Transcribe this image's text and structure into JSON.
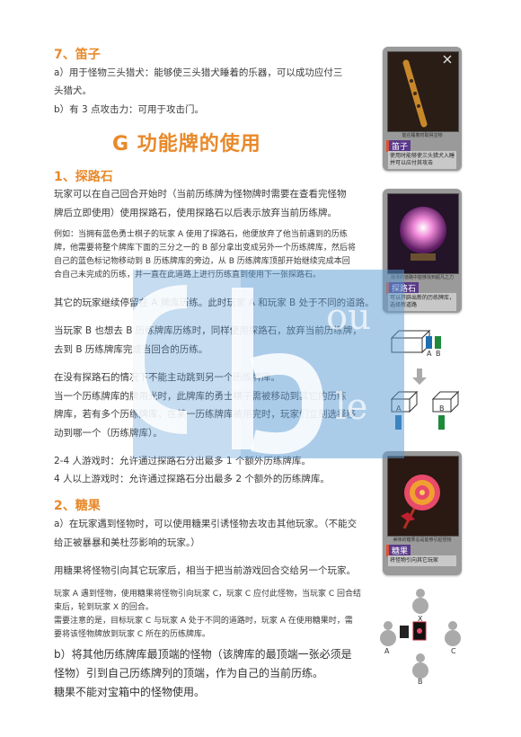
{
  "sec7": {
    "heading": "7、笛子",
    "line_a": "a）用于怪物三头猎犬：能够使三头猎犬睡着的乐器，可以成功应付三",
    "line_a2": "头猎犬。",
    "line_b": "b）有 3 点攻击力：可用于攻击门。"
  },
  "main_title": "G 功能牌的使用",
  "sec1": {
    "heading": "1、探路石",
    "p1_l1": "玩家可以在自己回合开始时（当前历练牌为怪物牌时需要在查看完怪物",
    "p1_l2": "牌后立即使用）使用探路石，使用探路石以后表示放弃当前历练牌。",
    "ex_l1": "例如：当拥有蓝色勇士棋子的玩家 A 使用了探路石，他便放弃了他当前遇到的历练",
    "ex_l2": "牌，他需要将整个牌库下面的三分之一的 B 部分拿出变成另外一个历练牌库，然后将",
    "ex_l3": "自己的蓝色标记物移动到 B 历练牌库的旁边，从 B 历练牌库顶部开始继续完成本回",
    "ex_l4": "合自己未完成的历练，并一直在此道路上进行历练直到使用下一张探路石。",
    "p2": "其它的玩家继续停留在 A 牌库历练。此时玩家 A 和玩家 B 处于不同的道路。",
    "p3_l1": "当玩家 B 也想去 B 历练牌库历练时，同样使用探路石，放弃当前历练牌，",
    "p3_l2": "去到 B 历练牌库完成当回合的历练。",
    "p4_l1": "在没有探路石的情况下不能主动跳到另一个历练牌库。",
    "p4_l2": "当一个历练牌库的牌用光时，此牌库的勇士棋子需被移动到其它的历练",
    "p4_l3": "牌库，若有多个历练牌库，在某一历练牌库被用完时，玩家们立刻选择移",
    "p4_l4": "动到哪一个（历练牌库）。",
    "p5_l1": "2-4 人游戏时：允许通过探路石分出最多 1 个额外历练牌库。",
    "p5_l2": "4 人以上游戏时：允许通过探路石分出最多 2 个额外的历练牌库。"
  },
  "sec2": {
    "heading": "2、糖果",
    "a_l1": "a）在玩家遇到怪物时，可以使用糖果引诱怪物去攻击其他玩家。（不能交",
    "a_l2": "给正被暴暴和美杜莎影响的玩家。）",
    "p1": "用糖果将怪物引向其它玩家后，相当于把当前游戏回合交给另一个玩家。",
    "s_l1": "玩家 A 遇到怪物，使用糖果将怪物引向玩家 C，玩家 C 应付此怪物，当玩家 C 回合结",
    "s_l2": "束后，轮到玩家 X 的回合。",
    "s_l3": "需要注意的是，目标玩家 C 与玩家 A 处于不同的道路时，玩家 A 在使用糖果时，需",
    "s_l4": "要将该怪物牌放到玩家 C 所在的历练牌库。",
    "b_l1": "b）将其他历练牌库最顶端的怪物（该牌库的最顶端一张必须是",
    "b_l2": "怪物）引到自己历练牌列的顶端，作为自己的当前历练。",
    "b_l3": "糖果不能对宝箱中的怪物使用。"
  },
  "cards": {
    "flute": {
      "name": "笛子",
      "art_caption": "能在睡着时取得宝物",
      "text": "使用时能够使三头猎犬入睡并可以应付其攻击"
    },
    "stone": {
      "name": "探路石",
      "art_caption": "找寻的道路中能够找到超凡之力",
      "text": "可以开辟出新的历练牌库，选择新道路"
    },
    "candy": {
      "name": "糖果",
      "art_caption": "美味的糖果总是能够引起怪物",
      "text": "将怪物引向其它玩家"
    }
  },
  "diagram1": {
    "label_a": "A",
    "label_b": "B",
    "down_a": "A",
    "down_b": "B"
  },
  "diagram2": {
    "label_x": "X",
    "label_a": "A",
    "label_b": "B",
    "label_c": "C"
  },
  "watermark": {
    "text1": "ou",
    "text2": "le"
  },
  "colors": {
    "orange": "#e8892a",
    "blue": "#1e6fb0",
    "green": "#1e8a3a",
    "watermark": "#5b9bd5"
  }
}
